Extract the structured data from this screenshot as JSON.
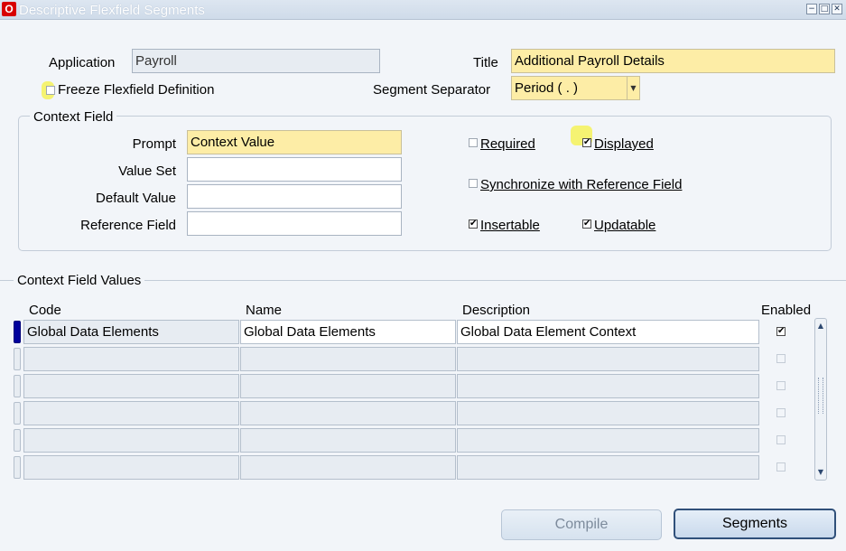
{
  "window": {
    "title": "Descriptive Flexfield Segments",
    "app_icon_letter": "O",
    "controls": {
      "minimize": "−",
      "restore": "□",
      "close": "✕"
    }
  },
  "form": {
    "application_label": "Application",
    "application_value": "Payroll",
    "title_label": "Title",
    "title_value": "Additional Payroll Details",
    "freeze_label": "Freeze Flexfield Definition",
    "freeze_checked": false,
    "segment_separator_label": "Segment Separator",
    "segment_separator_value": "Period ( . )"
  },
  "context_field": {
    "group_title": "Context Field",
    "prompt_label": "Prompt",
    "prompt_value": "Context Value",
    "value_set_label": "Value Set",
    "value_set_value": "",
    "default_value_label": "Default Value",
    "default_value_value": "",
    "reference_field_label": "Reference Field",
    "reference_field_value": "",
    "required_label": "Required",
    "required_checked": false,
    "displayed_label": "Displayed",
    "displayed_checked": true,
    "synchronize_label": "Synchronize with Reference Field",
    "synchronize_checked": false,
    "insertable_label": "Insertable",
    "insertable_checked": true,
    "updatable_label": "Updatable",
    "updatable_checked": true
  },
  "values_table": {
    "section_title": "Context Field Values",
    "columns": {
      "code": "Code",
      "name": "Name",
      "description": "Description",
      "enabled": "Enabled"
    },
    "rows": [
      {
        "code": "Global Data Elements",
        "name": "Global Data Elements",
        "description": "Global Data Element Context",
        "enabled": true
      },
      {
        "code": "",
        "name": "",
        "description": "",
        "enabled": false
      },
      {
        "code": "",
        "name": "",
        "description": "",
        "enabled": false
      },
      {
        "code": "",
        "name": "",
        "description": "",
        "enabled": false
      },
      {
        "code": "",
        "name": "",
        "description": "",
        "enabled": false
      },
      {
        "code": "",
        "name": "",
        "description": "",
        "enabled": false
      }
    ]
  },
  "buttons": {
    "compile_label": "Compile",
    "segments_label": "Segments"
  },
  "icons": {
    "check": "✔",
    "dropdown": "▼",
    "scroll_up": "▲",
    "scroll_down": "▼"
  },
  "colors": {
    "required_field": "#fdeda6",
    "highlight": "#f4f26a",
    "active_row": "#00009c",
    "title_bar": "#cfdbe9"
  }
}
